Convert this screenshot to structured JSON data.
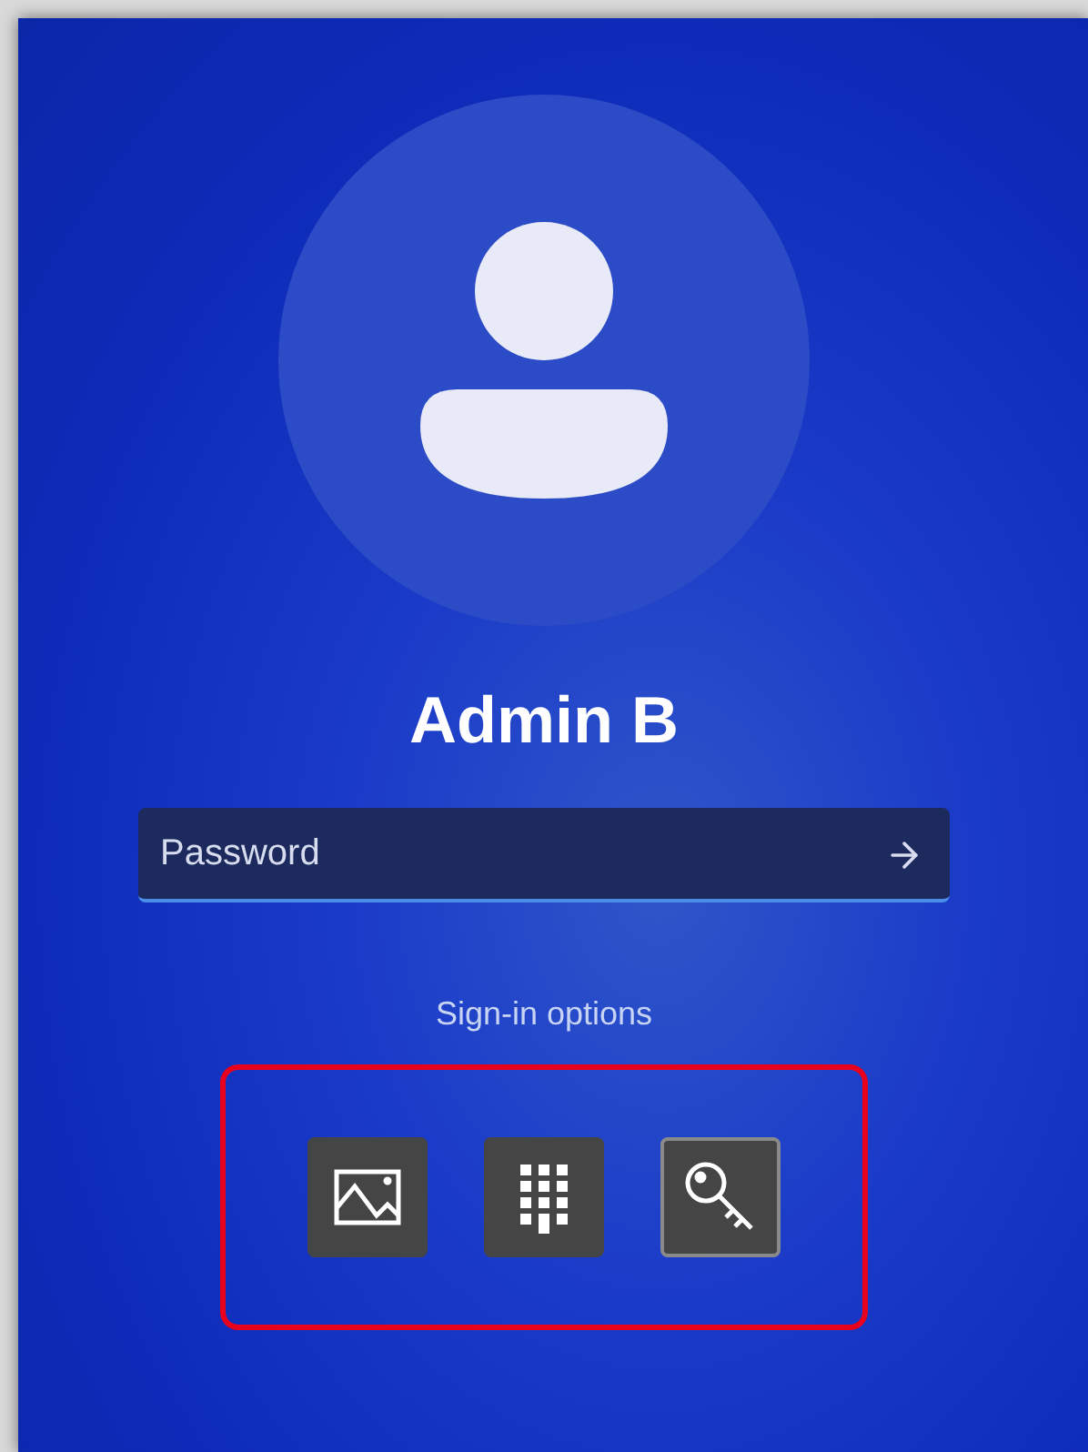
{
  "user": {
    "name": "Admin B"
  },
  "password": {
    "placeholder": "Password"
  },
  "sign_in_options": {
    "label": "Sign-in options",
    "highlighted": true,
    "options": [
      {
        "kind": "picture",
        "selected": false
      },
      {
        "kind": "pin",
        "selected": false
      },
      {
        "kind": "password",
        "selected": true
      }
    ]
  }
}
